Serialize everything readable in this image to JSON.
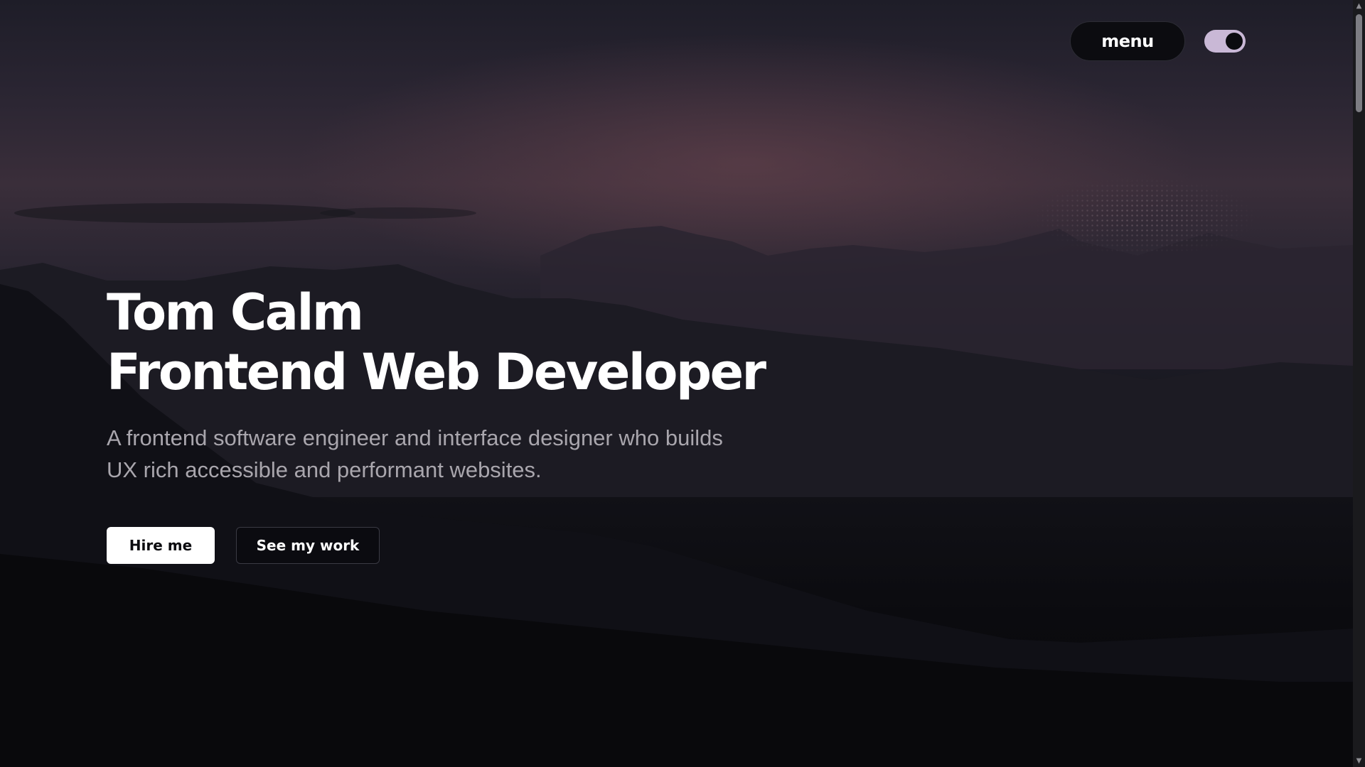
{
  "header": {
    "menu_label": "menu",
    "theme_toggle": {
      "state": "on",
      "track_color": "#c9b8d6",
      "knob_color": "#0b0b0f"
    }
  },
  "hero": {
    "name": "Tom Calm",
    "role": "Frontend Web Developer",
    "description": "A frontend software engineer and interface designer who builds UX rich accessible and performant websites.",
    "primary_cta": "Hire me",
    "secondary_cta": "See my work"
  },
  "scrollbar": {
    "up_icon": "up-arrow-icon",
    "down_icon": "down-arrow-icon",
    "up_glyph": "▲",
    "down_glyph": "▼"
  },
  "colors": {
    "background": "#0b0b0f",
    "text_primary": "#ffffff",
    "text_secondary": "#a9a6ad"
  }
}
